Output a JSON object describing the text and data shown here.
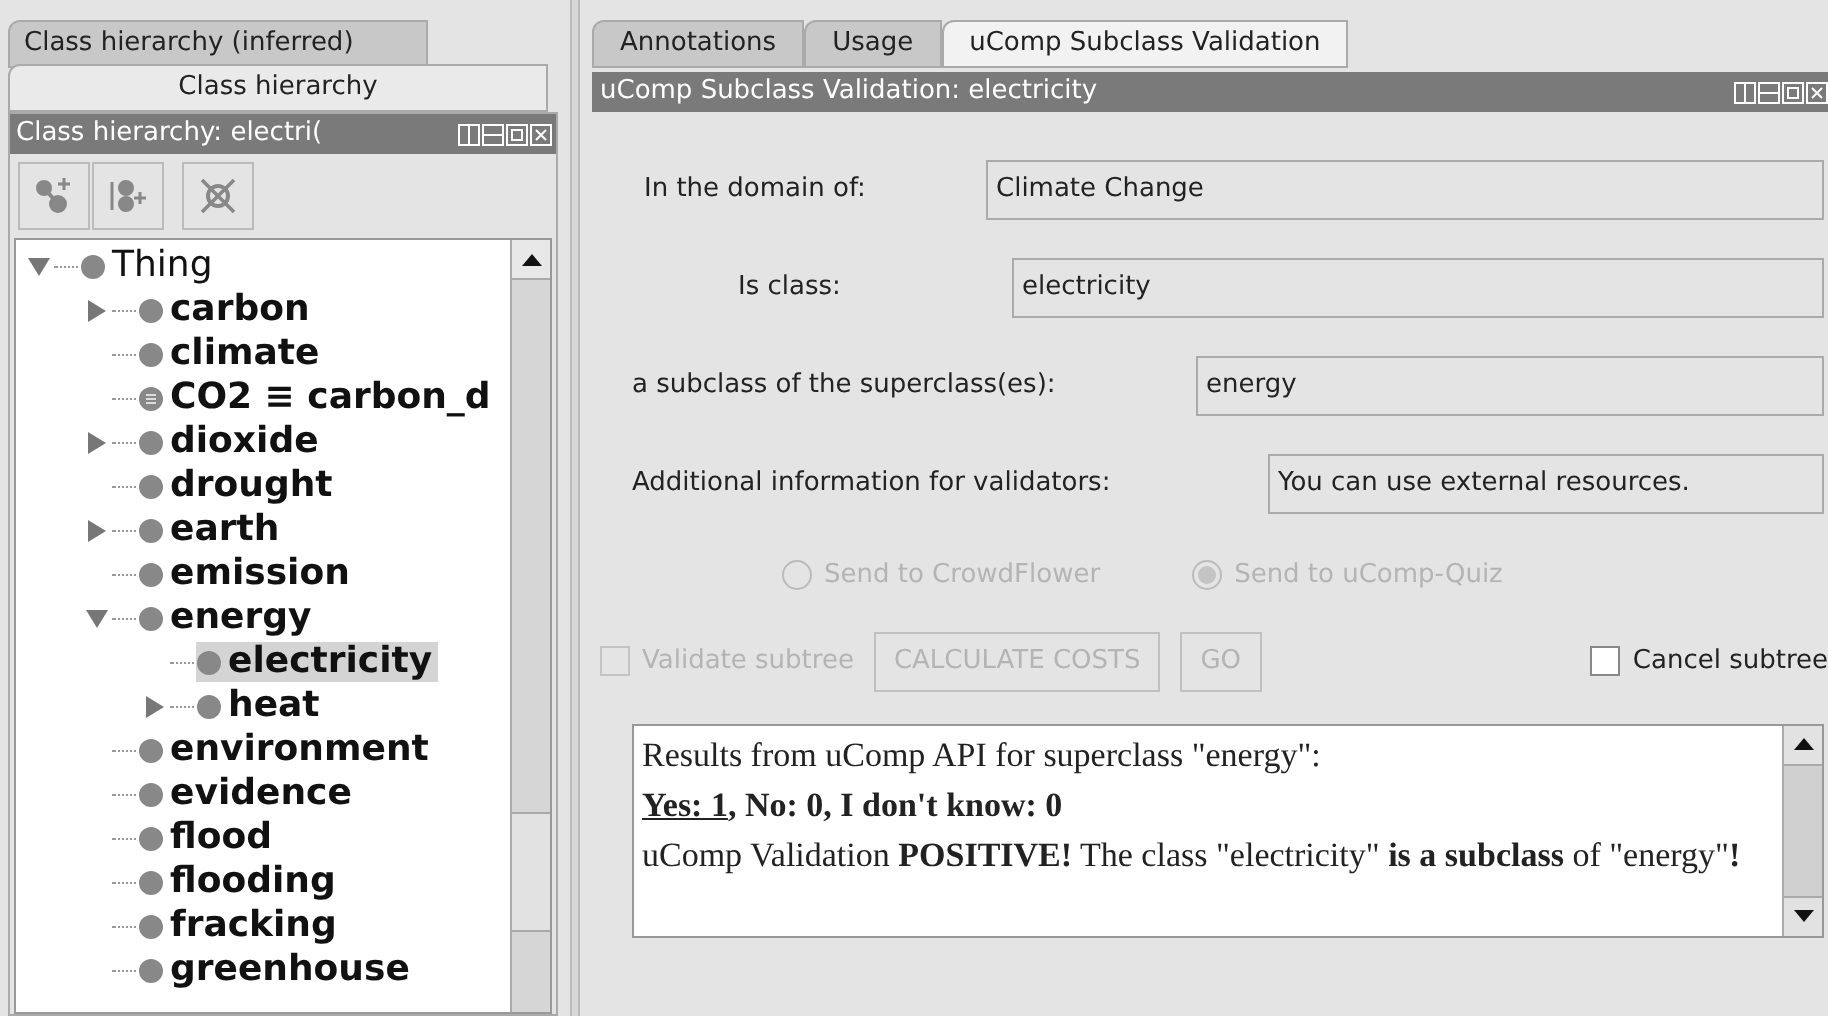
{
  "left_tabs": [
    {
      "label": "Class hierarchy (inferred)",
      "selected": false
    },
    {
      "label": "Class hierarchy",
      "selected": true
    }
  ],
  "left_panel": {
    "title": "Class hierarchy: electri(",
    "toolbar": [
      {
        "kind": "add-sub"
      },
      {
        "kind": "add-sibling"
      },
      {
        "kind": "delete"
      }
    ],
    "tree": [
      {
        "label": "Thing",
        "kind": "root",
        "expanded": true,
        "selected": false,
        "children": [
          {
            "label": "carbon",
            "kind": "branch",
            "expanded": false,
            "selected": false
          },
          {
            "label": "climate",
            "kind": "leaf",
            "selected": false
          },
          {
            "label": "CO2 ≡ carbon_d",
            "kind": "equivalent",
            "selected": false
          },
          {
            "label": "dioxide",
            "kind": "branch",
            "expanded": false,
            "selected": false
          },
          {
            "label": "drought",
            "kind": "leaf",
            "selected": false
          },
          {
            "label": "earth",
            "kind": "branch",
            "expanded": false,
            "selected": false
          },
          {
            "label": "emission",
            "kind": "leaf",
            "selected": false
          },
          {
            "label": "energy",
            "kind": "branch",
            "expanded": true,
            "selected": false,
            "children": [
              {
                "label": "electricity",
                "kind": "leaf",
                "selected": true
              },
              {
                "label": "heat",
                "kind": "branch",
                "expanded": false,
                "selected": false
              }
            ]
          },
          {
            "label": "environment",
            "kind": "leaf",
            "selected": false
          },
          {
            "label": "evidence",
            "kind": "leaf",
            "selected": false
          },
          {
            "label": "flood",
            "kind": "leaf",
            "selected": false
          },
          {
            "label": "flooding",
            "kind": "leaf",
            "selected": false
          },
          {
            "label": "fracking",
            "kind": "leaf",
            "selected": false
          },
          {
            "label": "greenhouse",
            "kind": "leaf",
            "selected": false
          }
        ]
      }
    ]
  },
  "right_tabs": [
    {
      "label": "Annotations",
      "selected": false
    },
    {
      "label": "Usage",
      "selected": false
    },
    {
      "label": "uComp Subclass Validation",
      "selected": true
    }
  ],
  "right_panel": {
    "title": "uComp Subclass Validation: electricity",
    "fields": [
      {
        "label": "In the domain of:",
        "value": "Climate Change"
      },
      {
        "label": "Is class:",
        "value": "electricity"
      },
      {
        "label": "a subclass of the superclass(es):",
        "value": "energy"
      },
      {
        "label": "Additional information for validators:",
        "value": "You can use external resources."
      }
    ],
    "radios": [
      {
        "label": "Send to CrowdFlower",
        "selected": false,
        "disabled": true
      },
      {
        "label": "Send to uComp-Quiz",
        "selected": true,
        "disabled": true
      }
    ],
    "validate_subtree": {
      "label": "Validate subtree",
      "checked": false,
      "disabled": true
    },
    "buttons": [
      {
        "label": "CALCULATE COSTS",
        "disabled": true
      },
      {
        "label": "GO",
        "disabled": true
      }
    ],
    "cancel_subtree": {
      "label": "Cancel subtree",
      "checked": false,
      "disabled": false
    },
    "results": {
      "line1": "Results from uComp API for superclass \"energy\":",
      "line2_underlined": "Yes: 1",
      "line2_rest": ", No: 0, I don't know: 0",
      "message": "uComp Validation **POSITIVE!** The class \"electricity\" **is a subclass** of \"energy\"**!**"
    }
  }
}
